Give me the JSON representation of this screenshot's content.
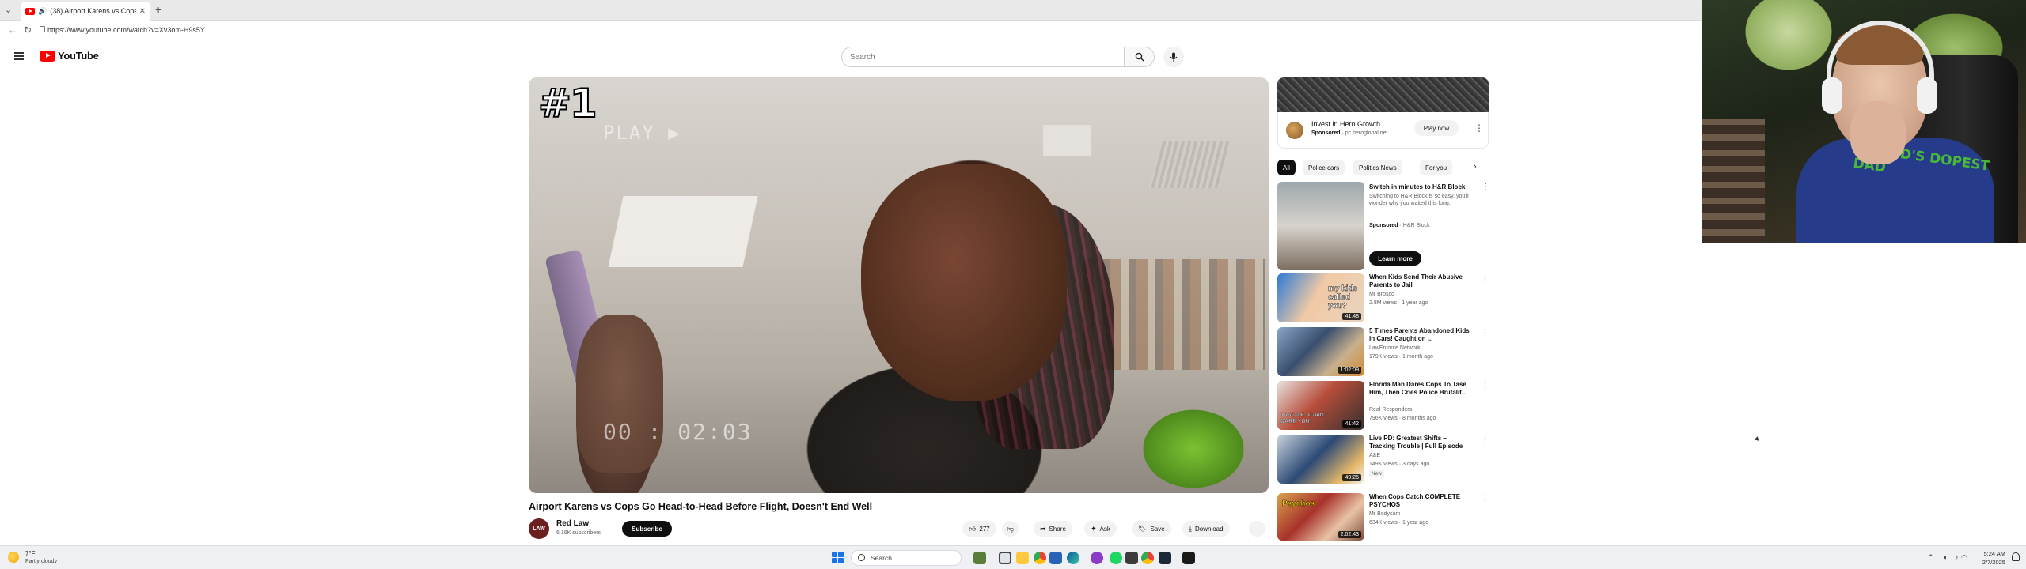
{
  "browser": {
    "tab_title": "(38) Airport Karens vs Cops",
    "new_tab": "+",
    "url": "https://www.youtube.com/watch?v=Xv3om-H9s5Y"
  },
  "header": {
    "logo_text": "YouTube",
    "search_placeholder": "Search"
  },
  "player": {
    "rank_badge": "#1",
    "overlay_text": "PLAY ▶",
    "timecode": "00 : 02:03"
  },
  "video": {
    "title": "Airport Karens vs Cops Go Head-to-Head Before Flight, Doesn't End Well",
    "channel_name": "Red Law",
    "channel_avatar_text": "LAW",
    "subscriber_count": "6.16K subscribers",
    "subscribe_label": "Subscribe",
    "like_count": "277",
    "share_label": "Share",
    "ask_label": "Ask",
    "save_label": "Save",
    "download_label": "Download"
  },
  "ad": {
    "title": "Invest in Hero Growth",
    "sponsored_label": "Sponsored",
    "advertiser": "pc.heroglobal.net",
    "play_label": "Play now"
  },
  "chips": [
    {
      "label": "All"
    },
    {
      "label": "Police cars"
    },
    {
      "label": "Politics News"
    },
    {
      "label": "For you"
    }
  ],
  "sponsored_video": {
    "title": "Switch in minutes to H&R Block",
    "description": "Switching to H&R Block is so easy, you'll wonder why you waited this long.",
    "sponsored_label": "Sponsored",
    "advertiser": "H&R Block",
    "button_label": "Learn more"
  },
  "recommendations": [
    {
      "title": "When Kids Send Their Abusive Parents to Jail",
      "channel": "Mr Brosco",
      "meta": "2.8M views · 1 year ago",
      "duration": "41:48",
      "thumb_text": "my kids called you?",
      "badge": ""
    },
    {
      "title": "5 Times Parents Abandoned Kids in Cars! Caught on ...",
      "channel": "LawEnforce Network",
      "meta": "179K views · 1 month ago",
      "duration": "1:02:09",
      "thumb_text": "",
      "badge": ""
    },
    {
      "title": "Florida Man Dares Cops To Tase Him, Then Cries Police Brutalit...",
      "channel": "Real Responders",
      "meta": "796K views · 8 months ago",
      "duration": "41:42",
      "thumb_text": "TASE ME AGAIN I DARE YOU!",
      "badge": ""
    },
    {
      "title": "Live PD: Greatest Shifts – Tracking Trouble | Full Episode",
      "channel": "A&E",
      "meta": "149K views · 3 days ago",
      "duration": "49:25",
      "thumb_text": "",
      "badge": "New"
    },
    {
      "title": "When Cops Catch COMPLETE PSYCHOS",
      "channel": "Mr Bodycam",
      "meta": "634K views · 1 year ago",
      "duration": "2:02:43",
      "thumb_text": "Psychos",
      "badge": ""
    }
  ],
  "taskbar": {
    "weather_temp": "7°F",
    "weather_desc": "Partly cloudy",
    "search_label": "Search",
    "time": "5:24 AM",
    "date": "2/7/2025"
  },
  "webcam": {
    "shirt_text": "WORLD'S DOPEST DAD"
  },
  "colors": {
    "youtube_red": "#ff0000",
    "subscribe_bg": "#0f0f0f",
    "chip_bg": "#f2f2f2",
    "taskbar_bg": "#eef0f3"
  }
}
